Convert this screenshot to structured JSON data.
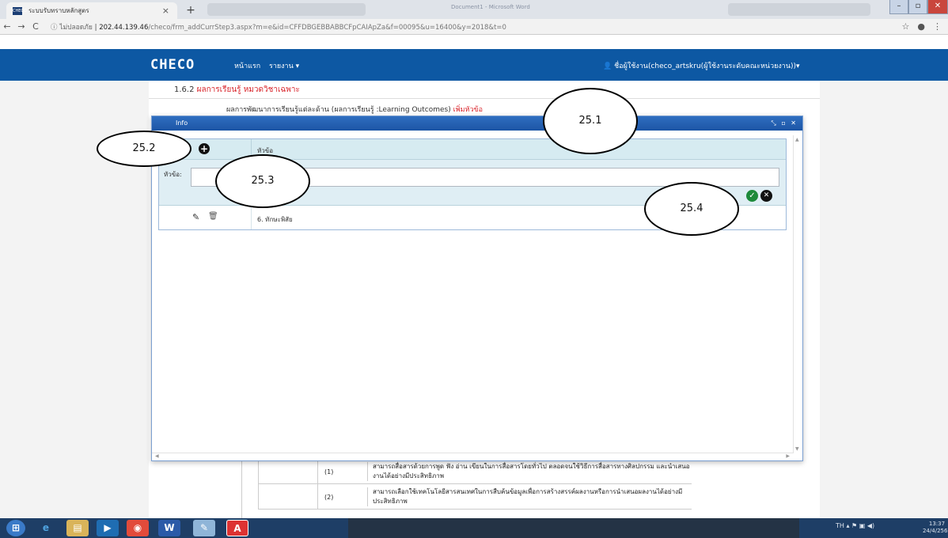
{
  "browser": {
    "tab_title": "ระบบรับทราบหลักสูตร",
    "tab_close": "×",
    "new_tab": "+",
    "favicon_text": "CHECO",
    "address_insecure": "ไม่ปลอดภัย",
    "address_host": "202.44.139.46",
    "address_path": "/checo/frm_addCurrStep3.aspx?m=e&id=CFFDBGEBBABBCFpCAIApZa&f=00095&u=16400&y=2018&t=0",
    "bg_tab_text": "Document1 - Microsoft Word"
  },
  "navbar": {
    "brand": "CHECO",
    "home": "หน้าแรก",
    "report": "รายงาน ▾",
    "user": "👤 ชื่อผู้ใช้งาน(checo_artskru(ผู้ใช้งานระดับคณะหน่วยงาน))▾"
  },
  "page": {
    "section_prefix": "1.6.2",
    "section_title": "ผลการเรียนรู้ หมวดวิชาเฉพาะ",
    "lo_title": "ผลการพัฒนาการเรียนรู้แต่ละด้าน (ผลการเรียนรู้ :Learning Outcomes)",
    "lo_add_link": "เพิ่มหัวข้อ",
    "bg_rows": [
      {
        "num": "(1)",
        "text": "สามารถสื่อสารด้วยการพูด ฟัง อ่าน เขียนในการสื่อสารโดยทั่วไป ตลอดจนใช้วิธีการสื่อสารทางศิลปกรรม และนำเสนองานได้อย่างมีประสิทธิภาพ"
      },
      {
        "num": "(2)",
        "text": "สามารถเลือกใช้เทคโนโลยีสารสนเทศในการสืบค้นข้อมูลเพื่อการสร้างสรรค์ผลงานหรือการนำเสนอผลงานได้อย่างมีประสิทธิภาพ"
      }
    ]
  },
  "modal": {
    "title": "Info",
    "controls": "⤡ ▫ ✕",
    "column_header": "หัวข้อ",
    "edit_label": "หัวข้อ:",
    "edit_value": "",
    "row_text": "6. ทักษะพิสัย"
  },
  "callouts": {
    "c1": "25.1",
    "c2": "25.2",
    "c3": "25.3",
    "c4": "25.4"
  },
  "taskbar": {
    "lang": "TH",
    "time": "13:37",
    "date": "24/4/2562"
  }
}
